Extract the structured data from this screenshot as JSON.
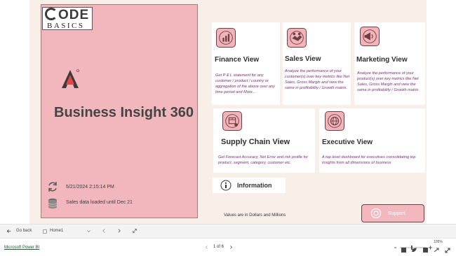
{
  "logo": {
    "top": "ODE",
    "bottom": "BASICS"
  },
  "app_title": "Business Insight 360",
  "refresh_timestamp": "5/21/2024 2:15:14 PM",
  "sales_loaded": "Sales data loaded until Dec 21",
  "cards": {
    "finance": {
      "title": "Finance View",
      "desc": "Get P & L statement for any customer / product / country or aggregation of the above over any time period and More...",
      "icon": "finance-chart-icon"
    },
    "sales": {
      "title": "Sales View",
      "desc": "Analyze the performance of your customer(s) over key metrics like Net Sales, Gross Margin and view the same in profitability / Growth matrix.",
      "icon": "sales-handshake-icon"
    },
    "marketing": {
      "title": "Marketing View",
      "desc": "Analyze the performance of your product(s) over key metrics like Net Sales, Gross Margin and view the same in profitability / Growth matrix.",
      "icon": "marketing-megaphone-icon"
    },
    "supply_chain": {
      "title": "Supply Chain View",
      "desc": "Get Forecast Accuracy, Net Error and risk profile for product, segment, category, customer etc.",
      "icon": "supply-chain-icon"
    },
    "executive": {
      "title": "Executive View",
      "desc": "A top level dashboard for executives consolidating top insights from all dimensions of business",
      "icon": "executive-globe-icon"
    }
  },
  "information_label": "Information",
  "values_note": "Values are in Dollars and Millions",
  "support_label": "Support",
  "nav": {
    "go_back": "Go back",
    "page_name": "Home1"
  },
  "footer": {
    "app_link": "Microsoft Power BI",
    "pager": "1 of 6",
    "zoom": "105%"
  },
  "colors": {
    "accent_pink": "#f1b7bd",
    "desc_purple": "#7a2f7a",
    "report_bg": "#f7efe8"
  }
}
